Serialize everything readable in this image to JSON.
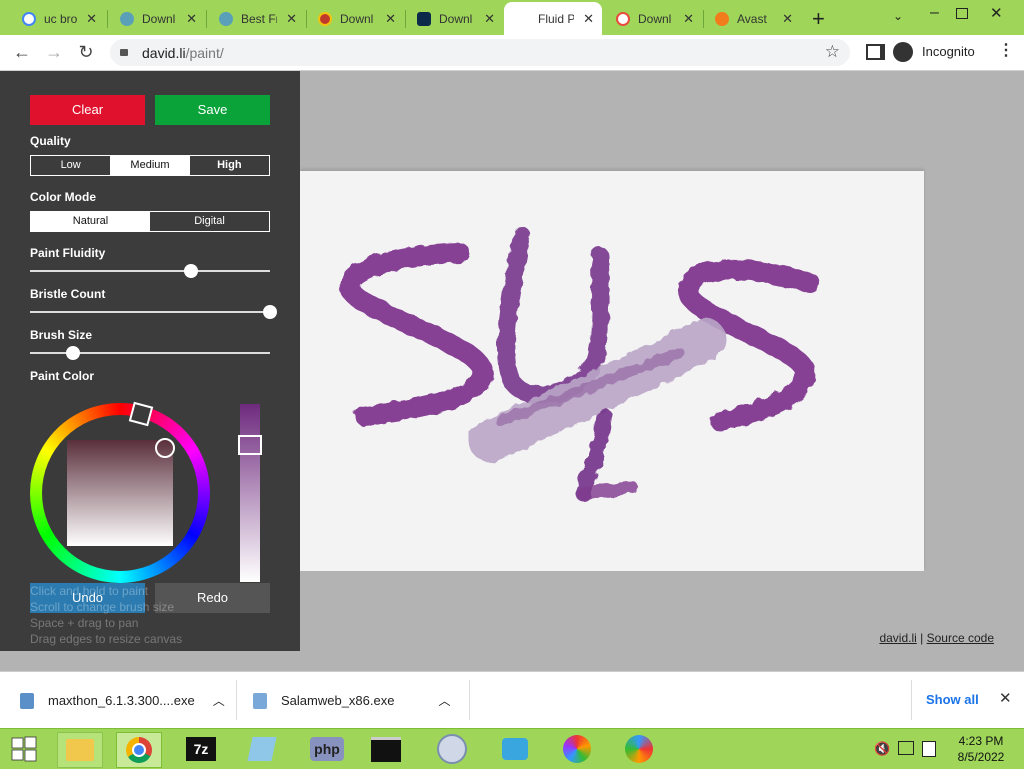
{
  "browser": {
    "tabs": [
      {
        "label": "uc bro",
        "favicon": "google-icon",
        "color": "#4285f4",
        "active": false
      },
      {
        "label": "Downl",
        "favicon": "globe-icon",
        "color": "#5aa0b8",
        "active": false
      },
      {
        "label": "Best Fr",
        "favicon": "globe-icon",
        "color": "#5aa0b8",
        "active": false
      },
      {
        "label": "Downl",
        "favicon": "chrome-icon",
        "color": "#c0392b",
        "active": false
      },
      {
        "label": "Downl",
        "favicon": "photoshop-icon",
        "color": "#0b2a4a",
        "active": false
      },
      {
        "label": "Fluid P",
        "favicon": "",
        "color": "#ffffff",
        "active": true
      },
      {
        "label": "Downl",
        "favicon": "softonic-icon",
        "color": "#e74c3c",
        "active": false
      },
      {
        "label": "Avast",
        "favicon": "avast-icon",
        "color": "#f07c1b",
        "active": false
      }
    ],
    "new_tab_symbol": "+",
    "url_domain": "david.li",
    "url_path": "/paint/",
    "incognito_label": "Incognito"
  },
  "paint": {
    "clear_label": "Clear",
    "save_label": "Save",
    "quality_label": "Quality",
    "quality_options": [
      "Low",
      "Medium",
      "High"
    ],
    "quality_selected": "Medium",
    "color_mode_label": "Color Mode",
    "color_mode_options": [
      "Natural",
      "Digital"
    ],
    "color_mode_selected": "Natural",
    "fluidity_label": "Paint Fluidity",
    "fluidity_value": 0.67,
    "bristle_label": "Bristle Count",
    "bristle_value": 1.0,
    "brush_size_label": "Brush Size",
    "brush_size_value": 0.18,
    "paint_color_label": "Paint Color",
    "paint_color": "#6e2a7e",
    "undo_label": "Undo",
    "redo_label": "Redo",
    "hints": [
      "Click and hold to paint",
      "Scroll to change brush size",
      "Space + drag to pan",
      "Drag edges to resize canvas"
    ],
    "footer_link_site": "david.li",
    "footer_separator": "|",
    "footer_link_source": "Source code"
  },
  "downloads": {
    "items": [
      {
        "name": "maxthon_6.1.3.300....exe"
      },
      {
        "name": "Salamweb_x86.exe"
      }
    ],
    "show_all_label": "Show all"
  },
  "taskbar": {
    "time": "4:23 PM",
    "date": "8/5/2022"
  },
  "colors": {
    "clear_button": "#e0112d",
    "save_button": "#0aa33a",
    "chrome_frame": "#9fd65a"
  }
}
